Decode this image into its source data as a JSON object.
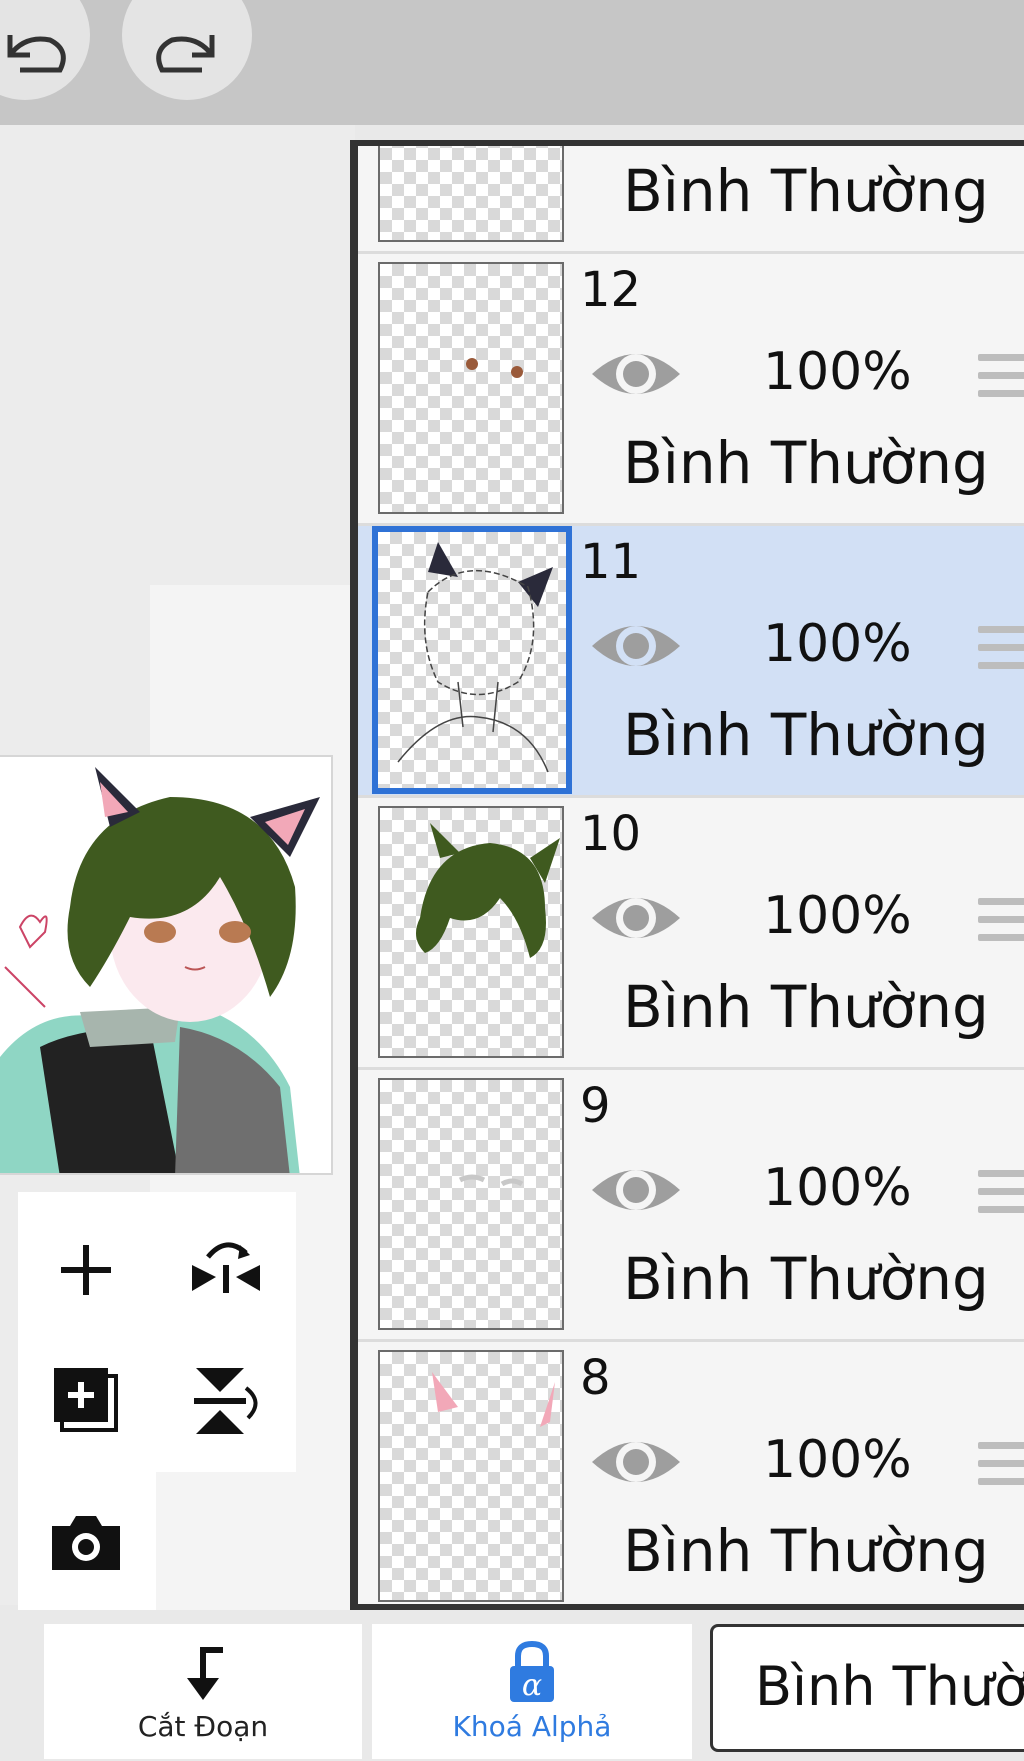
{
  "toolbar": {
    "undo_icon": "undo-icon",
    "redo_icon": "redo-icon"
  },
  "layers": [
    {
      "number": "",
      "opacity": "",
      "blend": "Bình Thường",
      "partial": true
    },
    {
      "number": "12",
      "opacity": "100%",
      "blend": "Bình Thường"
    },
    {
      "number": "11",
      "opacity": "100%",
      "blend": "Bình Thường",
      "selected": true
    },
    {
      "number": "10",
      "opacity": "100%",
      "blend": "Bình Thường"
    },
    {
      "number": "9",
      "opacity": "100%",
      "blend": "Bình Thường"
    },
    {
      "number": "8",
      "opacity": "100%",
      "blend": "Bình Thường"
    }
  ],
  "tools": {
    "add_layer_icon": "plus-icon",
    "flip_icon": "flip-horizontal-icon",
    "duplicate_icon": "add-layer-copy-icon",
    "merge_icon": "merge-down-icon",
    "camera_icon": "camera-icon"
  },
  "bottom_bar": {
    "clip_label": "Cắt Đoạn",
    "alpha_lock_label": "Khoá Alphả",
    "blend_mode_value": "Bình Thườ"
  },
  "colors": {
    "selected_row": "#d2e0f5",
    "selection_border": "#2f72d6",
    "alpha_lock_blue": "#2f7be0"
  }
}
